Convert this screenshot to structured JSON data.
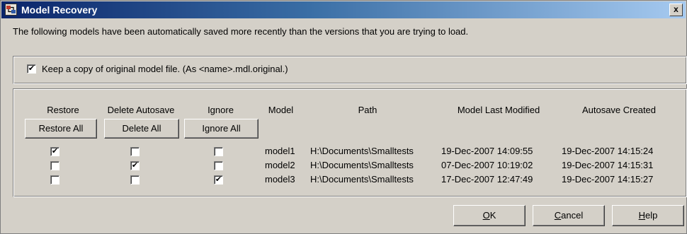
{
  "window": {
    "title": "Model Recovery",
    "close_label": "x"
  },
  "description": "The following models have been automatically saved more recently than the versions that you are trying to load.",
  "keep_copy": {
    "checked": true,
    "label": "Keep a copy of original model file. (As <name>.mdl.original.)"
  },
  "table": {
    "headers": {
      "restore": "Restore",
      "delete_autosave": "Delete Autosave",
      "ignore": "Ignore",
      "model": "Model",
      "path": "Path",
      "model_last_modified": "Model Last Modified",
      "autosave_created": "Autosave Created"
    },
    "buttons": {
      "restore_all": "Restore All",
      "delete_all": "Delete All",
      "ignore_all": "Ignore All"
    },
    "rows": [
      {
        "restore": true,
        "delete": false,
        "ignore": false,
        "model": "model1",
        "path": "H:\\Documents\\Smalltests",
        "modified": "19-Dec-2007 14:09:55",
        "autosave": "19-Dec-2007 14:15:24"
      },
      {
        "restore": false,
        "delete": true,
        "ignore": false,
        "model": "model2",
        "path": "H:\\Documents\\Smalltests",
        "modified": "07-Dec-2007 10:19:02",
        "autosave": "19-Dec-2007 14:15:31"
      },
      {
        "restore": false,
        "delete": false,
        "ignore": true,
        "model": "model3",
        "path": "H:\\Documents\\Smalltests",
        "modified": "17-Dec-2007 12:47:49",
        "autosave": "19-Dec-2007 14:15:27"
      }
    ]
  },
  "buttons": {
    "ok_mnemonic": "O",
    "ok_rest": "K",
    "cancel_mnemonic": "C",
    "cancel_rest": "ancel",
    "help_mnemonic": "H",
    "help_rest": "elp"
  },
  "check_glyph": "✔",
  "colors": {
    "title_start": "#0a246a",
    "title_end": "#a6caf0",
    "face": "#d4d0c8"
  }
}
